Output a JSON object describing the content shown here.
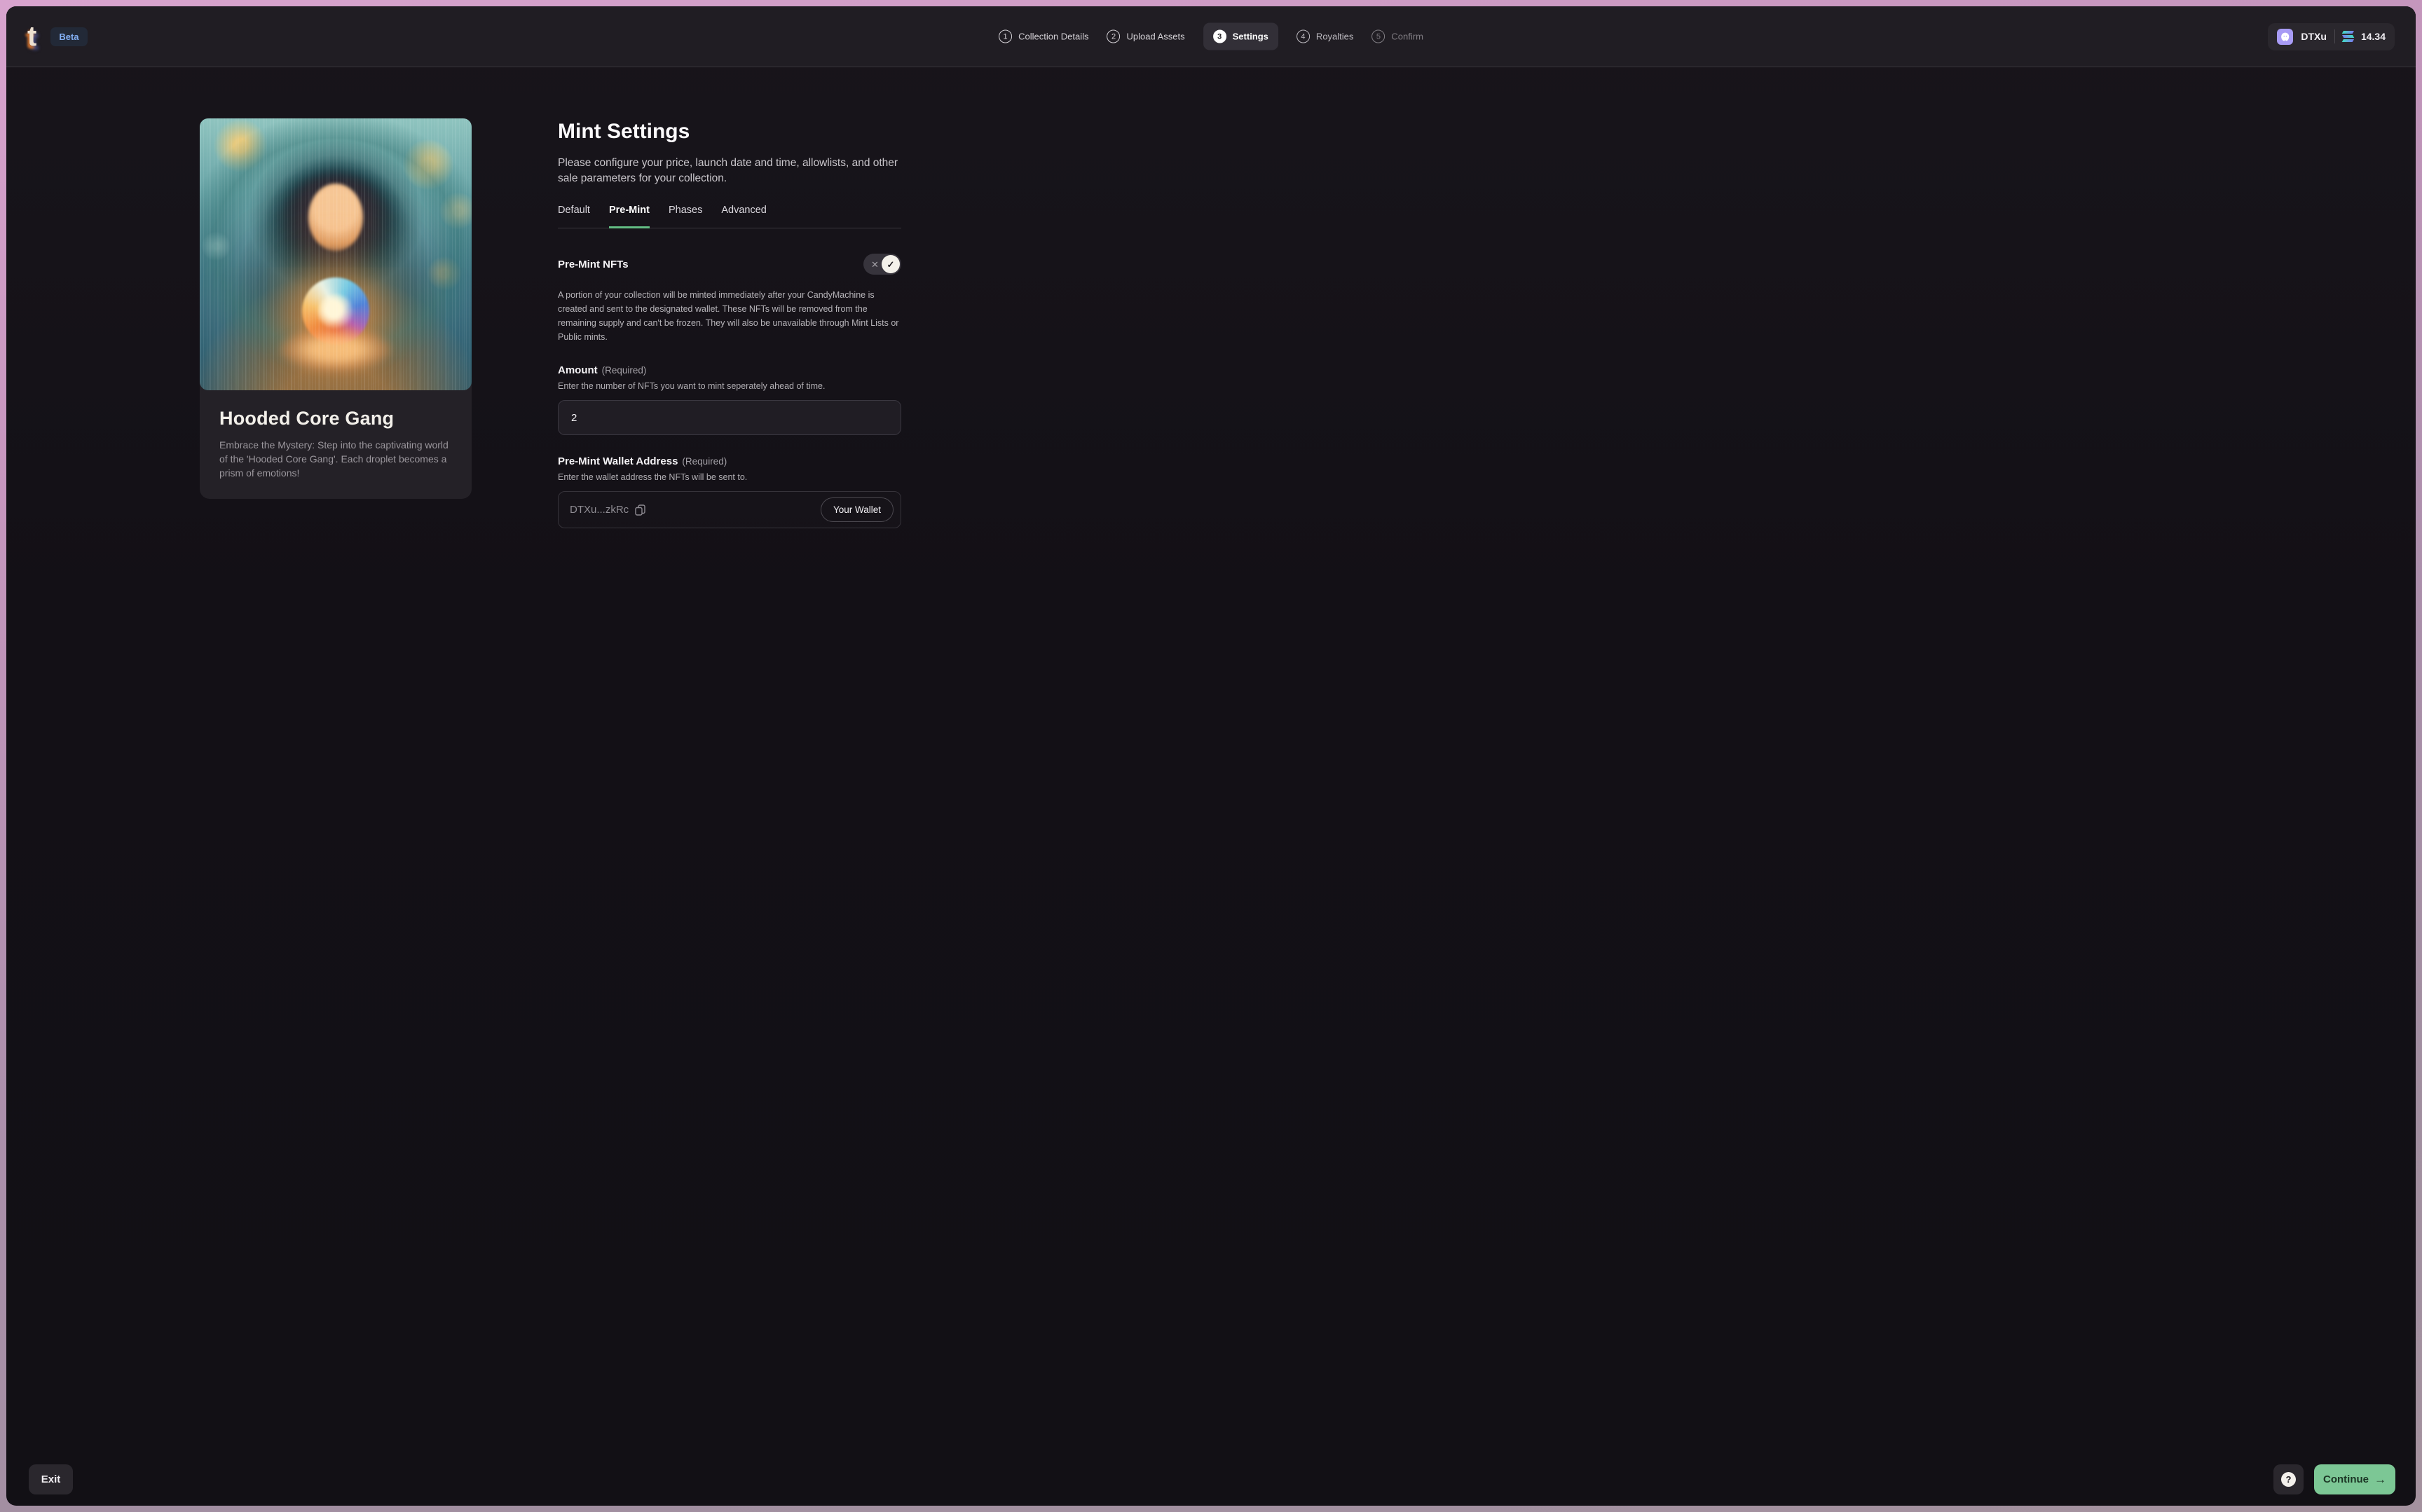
{
  "header": {
    "beta": "Beta",
    "steps": [
      {
        "num": "1",
        "label": "Collection Details"
      },
      {
        "num": "2",
        "label": "Upload Assets"
      },
      {
        "num": "3",
        "label": "Settings"
      },
      {
        "num": "4",
        "label": "Royalties"
      },
      {
        "num": "5",
        "label": "Confirm"
      }
    ],
    "active_step": "Settings",
    "wallet": {
      "name": "DTXu",
      "balance": "14.34"
    }
  },
  "card": {
    "title": "Hooded Core Gang",
    "description": "Embrace the Mystery: Step into the captivating world of the 'Hooded Core Gang'. Each droplet becomes a prism of emotions!"
  },
  "settings": {
    "title": "Mint Settings",
    "subtitle": "Please configure your price, launch date and time, allowlists, and other sale parameters for your collection.",
    "tabs": [
      {
        "label": "Default"
      },
      {
        "label": "Pre-Mint"
      },
      {
        "label": "Phases"
      },
      {
        "label": "Advanced"
      }
    ],
    "active_tab": "Pre-Mint",
    "premint_toggle": {
      "label": "Pre-Mint NFTs",
      "state": "on",
      "off_glyph": "✕",
      "on_glyph": "✓",
      "description": "A portion of your collection will be minted immediately after your CandyMachine is created and sent to the designated wallet. These NFTs will be removed from the remaining supply and can't be frozen. They will also be unavailable through Mint Lists or Public mints."
    },
    "amount": {
      "label": "Amount",
      "required": "(Required)",
      "help": "Enter the number of NFTs you want to mint seperately ahead of time.",
      "value": "2"
    },
    "wallet_address": {
      "label": "Pre-Mint Wallet Address",
      "required": "(Required)",
      "help": "Enter the wallet address the NFTs will be sent to.",
      "value": "DTXu...zkRc",
      "button": "Your Wallet"
    }
  },
  "footer": {
    "exit": "Exit",
    "help_glyph": "?",
    "continue": "Continue",
    "continue_arrow": "→"
  },
  "colors": {
    "accent_green": "#7cc795",
    "tab_underline": "#63bd83",
    "beta_text": "#83aff3",
    "phantom_purple": "#a89bf5",
    "frame_border_top": "#d8a4ce",
    "frame_border_bottom": "#a4929f"
  }
}
